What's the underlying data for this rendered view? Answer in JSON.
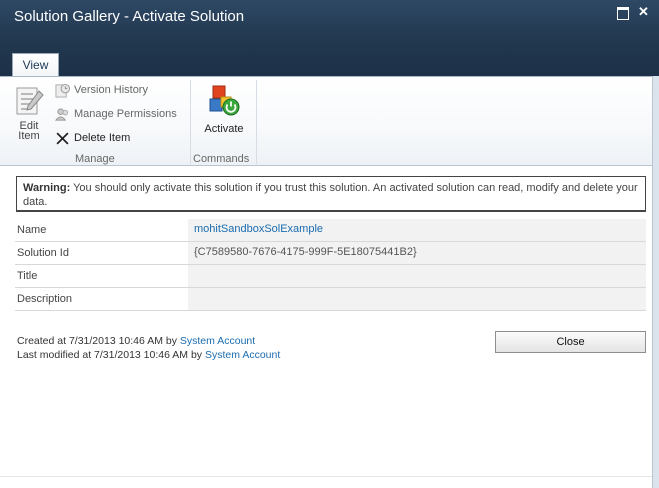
{
  "window": {
    "title": "Solution Gallery - Activate Solution",
    "maximize_icon": "maximize-icon",
    "close_icon": "close-icon",
    "close_glyph": "✕"
  },
  "ribbon": {
    "tab": "View",
    "manage": {
      "edit_item_line1": "Edit",
      "edit_item_line2": "Item",
      "version_history": "Version History",
      "manage_permissions": "Manage Permissions",
      "delete_item": "Delete Item",
      "group_label": "Manage"
    },
    "commands": {
      "activate": "Activate",
      "group_label": "Commands"
    }
  },
  "warning": {
    "label": "Warning:",
    "text": " You should only activate this solution if you trust this solution. An activated solution can read, modify and delete your data."
  },
  "fields": [
    {
      "label": "Name",
      "value": "mohitSandboxSolExample"
    },
    {
      "label": "Solution Id",
      "value": "{C7589580-7676-4175-999F-5E18075441B2}"
    },
    {
      "label": "Title",
      "value": ""
    },
    {
      "label": "Description",
      "value": ""
    }
  ],
  "meta": {
    "created_prefix": "Created at 7/31/2013 10:46 AM by ",
    "created_by": "System Account",
    "modified_prefix": "Last modified at 7/31/2013 10:46 AM by ",
    "modified_by": "System Account"
  },
  "buttons": {
    "close": "Close"
  },
  "colors": {
    "titlebar": "#22384f",
    "link": "#1b6cb0"
  }
}
